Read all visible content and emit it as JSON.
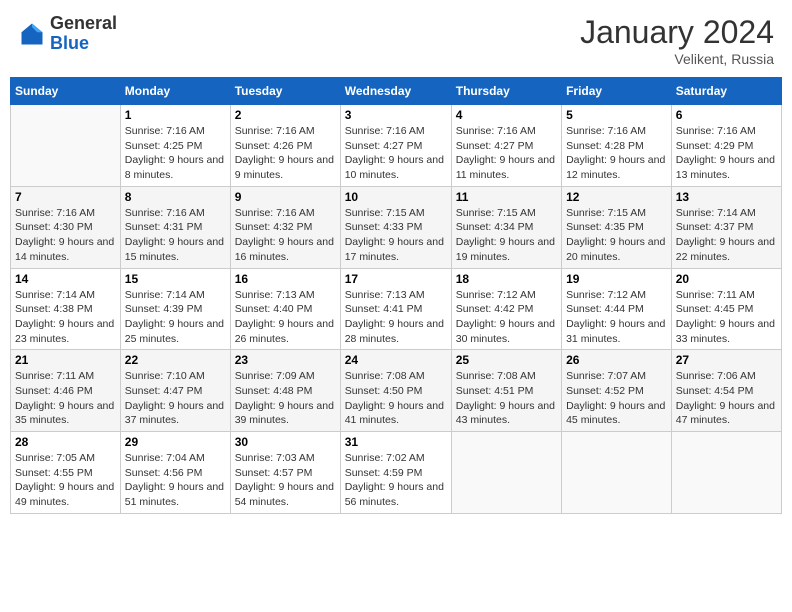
{
  "logo": {
    "general": "General",
    "blue": "Blue"
  },
  "title": {
    "month": "January 2024",
    "location": "Velikent, Russia"
  },
  "weekdays": [
    "Sunday",
    "Monday",
    "Tuesday",
    "Wednesday",
    "Thursday",
    "Friday",
    "Saturday"
  ],
  "weeks": [
    [
      {
        "day": "",
        "sunrise": "",
        "sunset": "",
        "daylight": ""
      },
      {
        "day": "1",
        "sunrise": "Sunrise: 7:16 AM",
        "sunset": "Sunset: 4:25 PM",
        "daylight": "Daylight: 9 hours and 8 minutes."
      },
      {
        "day": "2",
        "sunrise": "Sunrise: 7:16 AM",
        "sunset": "Sunset: 4:26 PM",
        "daylight": "Daylight: 9 hours and 9 minutes."
      },
      {
        "day": "3",
        "sunrise": "Sunrise: 7:16 AM",
        "sunset": "Sunset: 4:27 PM",
        "daylight": "Daylight: 9 hours and 10 minutes."
      },
      {
        "day": "4",
        "sunrise": "Sunrise: 7:16 AM",
        "sunset": "Sunset: 4:27 PM",
        "daylight": "Daylight: 9 hours and 11 minutes."
      },
      {
        "day": "5",
        "sunrise": "Sunrise: 7:16 AM",
        "sunset": "Sunset: 4:28 PM",
        "daylight": "Daylight: 9 hours and 12 minutes."
      },
      {
        "day": "6",
        "sunrise": "Sunrise: 7:16 AM",
        "sunset": "Sunset: 4:29 PM",
        "daylight": "Daylight: 9 hours and 13 minutes."
      }
    ],
    [
      {
        "day": "7",
        "sunrise": "Sunrise: 7:16 AM",
        "sunset": "Sunset: 4:30 PM",
        "daylight": "Daylight: 9 hours and 14 minutes."
      },
      {
        "day": "8",
        "sunrise": "Sunrise: 7:16 AM",
        "sunset": "Sunset: 4:31 PM",
        "daylight": "Daylight: 9 hours and 15 minutes."
      },
      {
        "day": "9",
        "sunrise": "Sunrise: 7:16 AM",
        "sunset": "Sunset: 4:32 PM",
        "daylight": "Daylight: 9 hours and 16 minutes."
      },
      {
        "day": "10",
        "sunrise": "Sunrise: 7:15 AM",
        "sunset": "Sunset: 4:33 PM",
        "daylight": "Daylight: 9 hours and 17 minutes."
      },
      {
        "day": "11",
        "sunrise": "Sunrise: 7:15 AM",
        "sunset": "Sunset: 4:34 PM",
        "daylight": "Daylight: 9 hours and 19 minutes."
      },
      {
        "day": "12",
        "sunrise": "Sunrise: 7:15 AM",
        "sunset": "Sunset: 4:35 PM",
        "daylight": "Daylight: 9 hours and 20 minutes."
      },
      {
        "day": "13",
        "sunrise": "Sunrise: 7:14 AM",
        "sunset": "Sunset: 4:37 PM",
        "daylight": "Daylight: 9 hours and 22 minutes."
      }
    ],
    [
      {
        "day": "14",
        "sunrise": "Sunrise: 7:14 AM",
        "sunset": "Sunset: 4:38 PM",
        "daylight": "Daylight: 9 hours and 23 minutes."
      },
      {
        "day": "15",
        "sunrise": "Sunrise: 7:14 AM",
        "sunset": "Sunset: 4:39 PM",
        "daylight": "Daylight: 9 hours and 25 minutes."
      },
      {
        "day": "16",
        "sunrise": "Sunrise: 7:13 AM",
        "sunset": "Sunset: 4:40 PM",
        "daylight": "Daylight: 9 hours and 26 minutes."
      },
      {
        "day": "17",
        "sunrise": "Sunrise: 7:13 AM",
        "sunset": "Sunset: 4:41 PM",
        "daylight": "Daylight: 9 hours and 28 minutes."
      },
      {
        "day": "18",
        "sunrise": "Sunrise: 7:12 AM",
        "sunset": "Sunset: 4:42 PM",
        "daylight": "Daylight: 9 hours and 30 minutes."
      },
      {
        "day": "19",
        "sunrise": "Sunrise: 7:12 AM",
        "sunset": "Sunset: 4:44 PM",
        "daylight": "Daylight: 9 hours and 31 minutes."
      },
      {
        "day": "20",
        "sunrise": "Sunrise: 7:11 AM",
        "sunset": "Sunset: 4:45 PM",
        "daylight": "Daylight: 9 hours and 33 minutes."
      }
    ],
    [
      {
        "day": "21",
        "sunrise": "Sunrise: 7:11 AM",
        "sunset": "Sunset: 4:46 PM",
        "daylight": "Daylight: 9 hours and 35 minutes."
      },
      {
        "day": "22",
        "sunrise": "Sunrise: 7:10 AM",
        "sunset": "Sunset: 4:47 PM",
        "daylight": "Daylight: 9 hours and 37 minutes."
      },
      {
        "day": "23",
        "sunrise": "Sunrise: 7:09 AM",
        "sunset": "Sunset: 4:48 PM",
        "daylight": "Daylight: 9 hours and 39 minutes."
      },
      {
        "day": "24",
        "sunrise": "Sunrise: 7:08 AM",
        "sunset": "Sunset: 4:50 PM",
        "daylight": "Daylight: 9 hours and 41 minutes."
      },
      {
        "day": "25",
        "sunrise": "Sunrise: 7:08 AM",
        "sunset": "Sunset: 4:51 PM",
        "daylight": "Daylight: 9 hours and 43 minutes."
      },
      {
        "day": "26",
        "sunrise": "Sunrise: 7:07 AM",
        "sunset": "Sunset: 4:52 PM",
        "daylight": "Daylight: 9 hours and 45 minutes."
      },
      {
        "day": "27",
        "sunrise": "Sunrise: 7:06 AM",
        "sunset": "Sunset: 4:54 PM",
        "daylight": "Daylight: 9 hours and 47 minutes."
      }
    ],
    [
      {
        "day": "28",
        "sunrise": "Sunrise: 7:05 AM",
        "sunset": "Sunset: 4:55 PM",
        "daylight": "Daylight: 9 hours and 49 minutes."
      },
      {
        "day": "29",
        "sunrise": "Sunrise: 7:04 AM",
        "sunset": "Sunset: 4:56 PM",
        "daylight": "Daylight: 9 hours and 51 minutes."
      },
      {
        "day": "30",
        "sunrise": "Sunrise: 7:03 AM",
        "sunset": "Sunset: 4:57 PM",
        "daylight": "Daylight: 9 hours and 54 minutes."
      },
      {
        "day": "31",
        "sunrise": "Sunrise: 7:02 AM",
        "sunset": "Sunset: 4:59 PM",
        "daylight": "Daylight: 9 hours and 56 minutes."
      },
      {
        "day": "",
        "sunrise": "",
        "sunset": "",
        "daylight": ""
      },
      {
        "day": "",
        "sunrise": "",
        "sunset": "",
        "daylight": ""
      },
      {
        "day": "",
        "sunrise": "",
        "sunset": "",
        "daylight": ""
      }
    ]
  ]
}
